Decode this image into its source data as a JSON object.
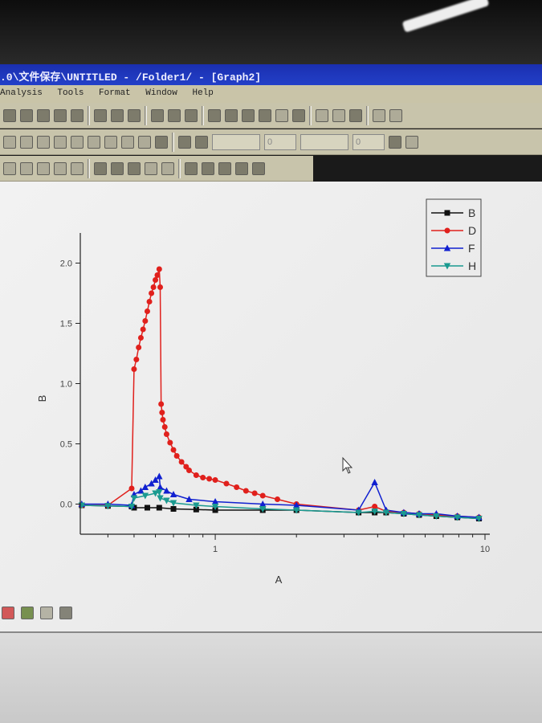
{
  "window": {
    "title": ".0\\文件保存\\UNTITLED - /Folder1/ - [Graph2]"
  },
  "menu": [
    "Analysis",
    "Tools",
    "Format",
    "Window",
    "Help"
  ],
  "format_toolbar": {
    "line_width": "0",
    "border_width": "0"
  },
  "colors": {
    "B": "#111111",
    "D": "#e0201c",
    "F": "#1020d0",
    "H": "#1a9a90",
    "titlebar": "#2340c8"
  },
  "chart_data": {
    "type": "line",
    "title": "",
    "xlabel": "A",
    "ylabel": "B",
    "xscale": "log",
    "xlim": [
      0.316,
      10
    ],
    "ylim": [
      -0.25,
      2.25
    ],
    "xticks": [
      {
        "v": 1,
        "label": "1"
      },
      {
        "v": 10,
        "label": "10"
      }
    ],
    "yticks": [
      {
        "v": 0,
        "label": "0.0"
      },
      {
        "v": 0.5,
        "label": "0.5"
      },
      {
        "v": 1,
        "label": "1.0"
      },
      {
        "v": 1.5,
        "label": "1.5"
      },
      {
        "v": 2,
        "label": "2.0"
      }
    ],
    "legend_position": "top-right",
    "series": [
      {
        "name": "B",
        "marker": "square",
        "points": [
          [
            0.32,
            -0.01
          ],
          [
            0.4,
            -0.015
          ],
          [
            0.49,
            -0.02
          ],
          [
            0.5,
            -0.03
          ],
          [
            0.56,
            -0.03
          ],
          [
            0.62,
            -0.03
          ],
          [
            0.7,
            -0.04
          ],
          [
            0.85,
            -0.045
          ],
          [
            1,
            -0.05
          ],
          [
            1.5,
            -0.05
          ],
          [
            2,
            -0.05
          ],
          [
            3.4,
            -0.07
          ],
          [
            3.9,
            -0.07
          ],
          [
            4.3,
            -0.07
          ],
          [
            5,
            -0.08
          ],
          [
            5.7,
            -0.09
          ],
          [
            6.6,
            -0.1
          ],
          [
            7.9,
            -0.11
          ],
          [
            9.5,
            -0.12
          ]
        ]
      },
      {
        "name": "D",
        "marker": "circle",
        "points": [
          [
            0.32,
            -0.01
          ],
          [
            0.4,
            -0.01
          ],
          [
            0.49,
            0.13
          ],
          [
            0.5,
            1.12
          ],
          [
            0.51,
            1.2
          ],
          [
            0.52,
            1.3
          ],
          [
            0.53,
            1.38
          ],
          [
            0.54,
            1.45
          ],
          [
            0.55,
            1.52
          ],
          [
            0.56,
            1.6
          ],
          [
            0.57,
            1.68
          ],
          [
            0.58,
            1.75
          ],
          [
            0.59,
            1.8
          ],
          [
            0.6,
            1.86
          ],
          [
            0.61,
            1.9
          ],
          [
            0.62,
            1.95
          ],
          [
            0.625,
            1.8
          ],
          [
            0.63,
            0.83
          ],
          [
            0.635,
            0.76
          ],
          [
            0.64,
            0.7
          ],
          [
            0.65,
            0.64
          ],
          [
            0.66,
            0.58
          ],
          [
            0.68,
            0.51
          ],
          [
            0.7,
            0.45
          ],
          [
            0.72,
            0.4
          ],
          [
            0.75,
            0.35
          ],
          [
            0.78,
            0.31
          ],
          [
            0.8,
            0.28
          ],
          [
            0.85,
            0.24
          ],
          [
            0.9,
            0.22
          ],
          [
            0.95,
            0.21
          ],
          [
            1.0,
            0.2
          ],
          [
            1.1,
            0.17
          ],
          [
            1.2,
            0.14
          ],
          [
            1.3,
            0.11
          ],
          [
            1.4,
            0.09
          ],
          [
            1.5,
            0.07
          ],
          [
            1.7,
            0.04
          ],
          [
            2.0,
            0.0
          ],
          [
            3.4,
            -0.05
          ],
          [
            3.9,
            -0.02
          ],
          [
            4.3,
            -0.06
          ],
          [
            5,
            -0.07
          ],
          [
            5.7,
            -0.08
          ],
          [
            6.6,
            -0.09
          ],
          [
            7.9,
            -0.1
          ],
          [
            9.5,
            -0.11
          ]
        ]
      },
      {
        "name": "F",
        "marker": "triangle-up",
        "points": [
          [
            0.32,
            0.0
          ],
          [
            0.4,
            0.0
          ],
          [
            0.49,
            -0.01
          ],
          [
            0.5,
            0.08
          ],
          [
            0.53,
            0.11
          ],
          [
            0.55,
            0.14
          ],
          [
            0.58,
            0.17
          ],
          [
            0.6,
            0.2
          ],
          [
            0.62,
            0.23
          ],
          [
            0.625,
            0.14
          ],
          [
            0.66,
            0.11
          ],
          [
            0.7,
            0.08
          ],
          [
            0.8,
            0.04
          ],
          [
            1.0,
            0.02
          ],
          [
            1.5,
            0.0
          ],
          [
            2.0,
            -0.01
          ],
          [
            3.4,
            -0.05
          ],
          [
            3.9,
            0.18
          ],
          [
            4.3,
            -0.05
          ],
          [
            5,
            -0.07
          ],
          [
            5.7,
            -0.08
          ],
          [
            6.6,
            -0.08
          ],
          [
            7.9,
            -0.1
          ],
          [
            9.5,
            -0.11
          ]
        ]
      },
      {
        "name": "H",
        "marker": "triangle-down",
        "points": [
          [
            0.32,
            -0.01
          ],
          [
            0.4,
            -0.015
          ],
          [
            0.49,
            -0.02
          ],
          [
            0.5,
            0.05
          ],
          [
            0.55,
            0.07
          ],
          [
            0.6,
            0.09
          ],
          [
            0.62,
            0.1
          ],
          [
            0.625,
            0.05
          ],
          [
            0.66,
            0.03
          ],
          [
            0.7,
            0.01
          ],
          [
            0.85,
            -0.01
          ],
          [
            1,
            -0.02
          ],
          [
            1.5,
            -0.04
          ],
          [
            2,
            -0.05
          ],
          [
            3.4,
            -0.07
          ],
          [
            3.9,
            -0.06
          ],
          [
            4.3,
            -0.07
          ],
          [
            5,
            -0.08
          ],
          [
            5.7,
            -0.09
          ],
          [
            6.6,
            -0.1
          ],
          [
            7.9,
            -0.11
          ],
          [
            9.5,
            -0.12
          ]
        ]
      }
    ]
  }
}
